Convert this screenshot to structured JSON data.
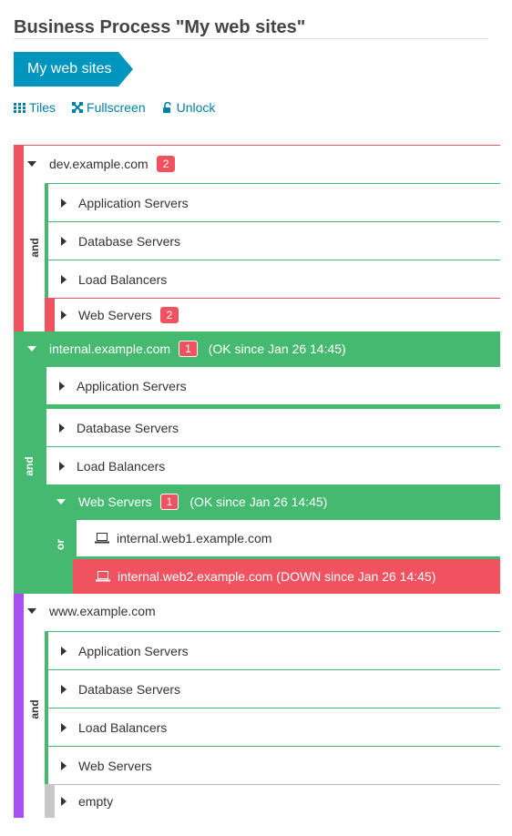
{
  "page": {
    "title": "Business Process \"My web sites\"",
    "breadcrumb": "My web sites",
    "actions": {
      "tiles": "Tiles",
      "fullscreen": "Fullscreen",
      "unlock": "Unlock"
    }
  },
  "colors": {
    "red": "#f0535f",
    "green": "#45b970",
    "purple": "#a54ff5",
    "blue": "#0095bf",
    "gray": "#c8c8c8"
  },
  "tree": {
    "dev": {
      "name": "dev.example.com",
      "badge": "2",
      "operator": "and",
      "children": [
        "Application Servers",
        "Database Servers",
        "Load Balancers",
        "Web Servers"
      ],
      "web_badge": "2"
    },
    "internal": {
      "name": "internal.example.com",
      "badge": "1",
      "status": "(OK since Jan 26 14:45)",
      "operator": "and",
      "children": [
        "Application Servers",
        "Database Servers",
        "Load Balancers"
      ],
      "web": {
        "name": "Web Servers",
        "badge": "1",
        "status": "(OK since Jan 26 14:45)",
        "operator": "or",
        "hosts": [
          "internal.web1.example.com",
          "internal.web2.example.com (DOWN since Jan 26 14:45)"
        ]
      }
    },
    "www": {
      "name": "www.example.com",
      "operator": "and",
      "children": [
        "Application Servers",
        "Database Servers",
        "Load Balancers",
        "Web Servers",
        "empty"
      ]
    }
  }
}
